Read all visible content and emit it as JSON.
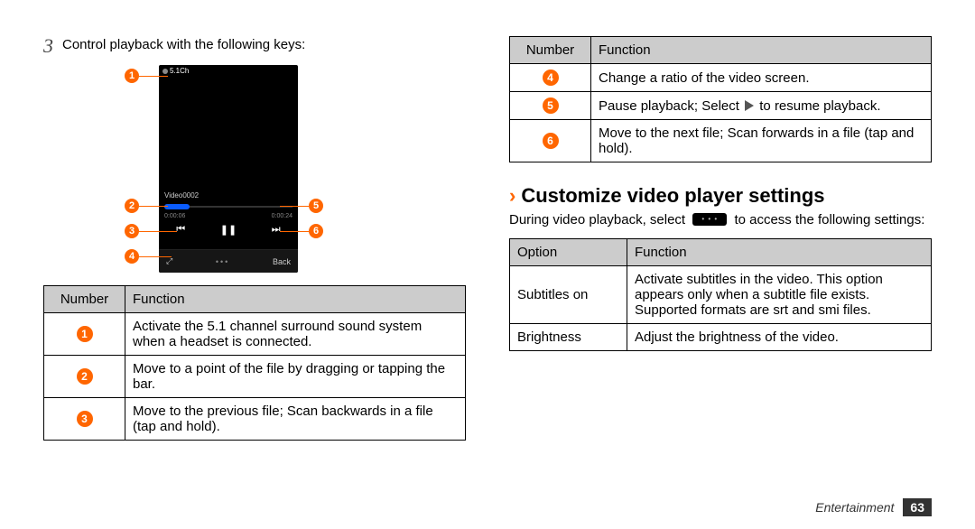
{
  "step": {
    "number": "3",
    "text": "Control playback with the following keys:"
  },
  "device": {
    "audio_badge": "5.1Ch",
    "video_title": "Video0002",
    "time_elapsed": "0:00:06",
    "time_total": "0:00:24",
    "back_label": "Back"
  },
  "callouts_left": [
    "1",
    "2",
    "3",
    "4"
  ],
  "callouts_right": [
    "5",
    "6"
  ],
  "table_left_header": {
    "number": "Number",
    "function": "Function"
  },
  "table_left_rows": [
    {
      "n": "1",
      "text": "Activate the 5.1 channel surround sound system when a headset is connected."
    },
    {
      "n": "2",
      "text": "Move to a point of the file by dragging or tapping the bar."
    },
    {
      "n": "3",
      "text": "Move to the previous file; Scan backwards in a file (tap and hold)."
    }
  ],
  "table_right_top_header": {
    "number": "Number",
    "function": "Function"
  },
  "table_right_top_rows": [
    {
      "n": "4",
      "text_full": "Change a ratio of the video screen."
    },
    {
      "n": "5",
      "text_before": "Pause playback; Select ",
      "text_after": " to resume playback."
    },
    {
      "n": "6",
      "text_full": "Move to the next file; Scan forwards in a file (tap and hold)."
    }
  ],
  "section_title": "Customize video player settings",
  "section_para_before": "During video playback, select ",
  "section_para_after": " to access the following settings:",
  "table_options_header": {
    "option": "Option",
    "function": "Function"
  },
  "table_options_rows": [
    {
      "option": "Subtitles on",
      "text": "Activate subtitles in the video. This option appears only when a subtitle file exists. Supported formats are srt and smi files."
    },
    {
      "option": "Brightness",
      "text": "Adjust the brightness of the video."
    }
  ],
  "footer": {
    "category": "Entertainment",
    "page": "63"
  }
}
